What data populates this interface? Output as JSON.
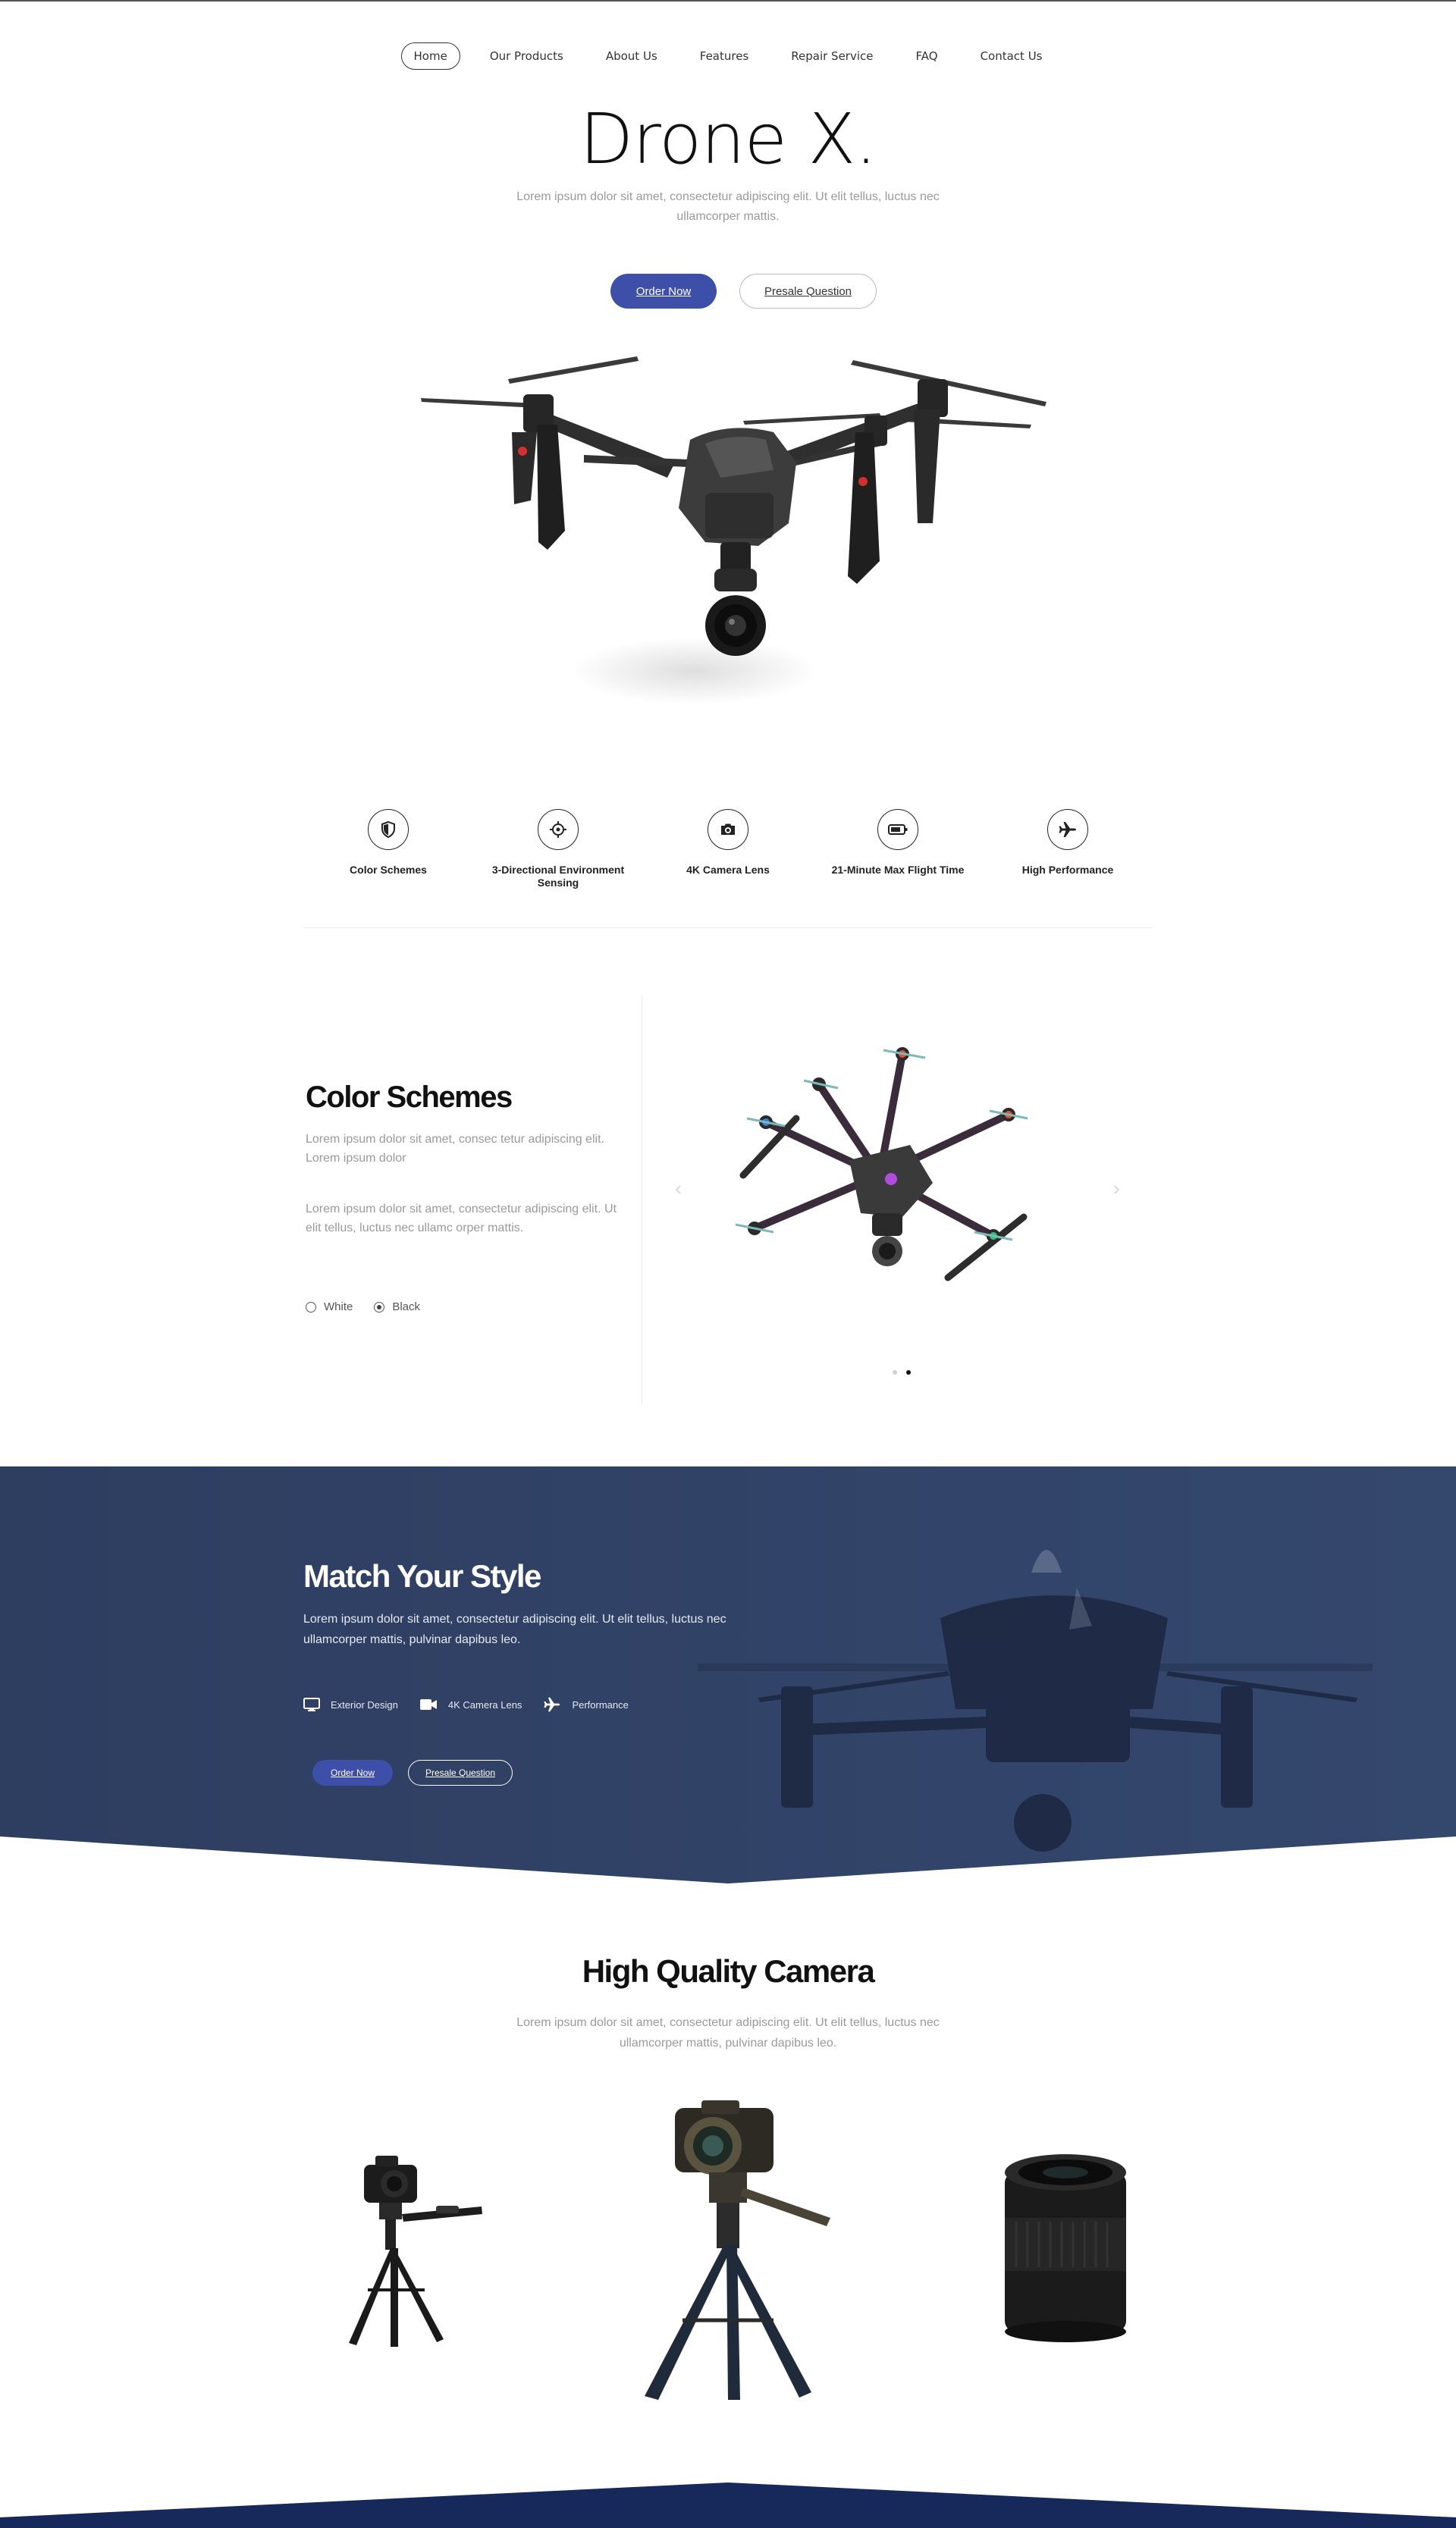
{
  "nav": {
    "items": [
      "Home",
      "Our Products",
      "About Us",
      "Features",
      "Repair Service",
      "FAQ",
      "Contact Us"
    ],
    "active": "Home"
  },
  "hero": {
    "title": "Drone X.",
    "subtitle": "Lorem ipsum dolor sit amet, consectetur adipiscing elit. Ut elit tellus, luctus nec ullamcorper mattis.",
    "order_label": "Order Now",
    "presale_label": "Presale Question"
  },
  "features": [
    {
      "icon": "shield-icon",
      "label": "Color Schemes"
    },
    {
      "icon": "crosshair-icon",
      "label": "3-Directional Environment Sensing"
    },
    {
      "icon": "camera-icon",
      "label": "4K Camera Lens"
    },
    {
      "icon": "battery-icon",
      "label": "21-Minute Max Flight Time"
    },
    {
      "icon": "airplane-icon",
      "label": "High Performance"
    }
  ],
  "color_schemes": {
    "title": "Color Schemes",
    "para1": "Lorem ipsum dolor sit amet, consec tetur adipiscing elit. Lorem ipsum dolor",
    "para2": "Lorem ipsum dolor sit amet, consectetur adipiscing elit. Ut elit tellus, luctus nec ullamc orper mattis.",
    "options": [
      "White",
      "Black"
    ],
    "selected": "Black",
    "slides_count": 2,
    "active_slide": 2
  },
  "match_style": {
    "title": "Match Your Style",
    "text": "Lorem ipsum dolor sit amet, consectetur adipiscing elit. Ut elit tellus, luctus nec ullamcorper mattis, pulvinar dapibus leo.",
    "features": [
      {
        "icon": "monitor-icon",
        "label": "Exterior Design"
      },
      {
        "icon": "video-camera-icon",
        "label": "4K Camera Lens"
      },
      {
        "icon": "airplane-icon",
        "label": "Performance"
      }
    ],
    "order_label": "Order Now",
    "presale_label": "Presale Question"
  },
  "high_quality": {
    "title": "High Quality Camera",
    "text": "Lorem ipsum dolor sit amet, consectetur adipiscing elit. Ut elit tellus, luctus nec ullamcorper mattis, pulvinar dapibus leo."
  },
  "colors": {
    "accent": "#3d4fa8",
    "band": "#2f4063",
    "footer_band": "#16295a"
  }
}
